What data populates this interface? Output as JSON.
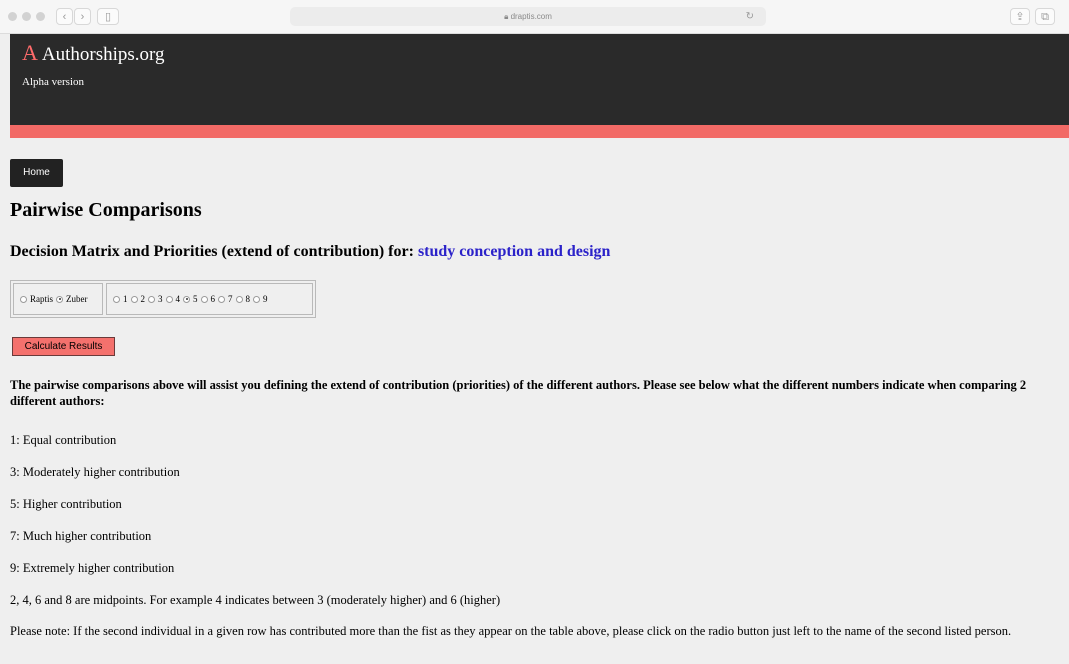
{
  "browser": {
    "url": "draptis.com",
    "icons": [
      "reader-icon",
      "reload-icon",
      "share-icon",
      "tabs-icon"
    ]
  },
  "site": {
    "logo_letter": "A",
    "name": "Authorships.org",
    "tagline": "Alpha version",
    "colors": {
      "header": "#2a2a2a",
      "accent": "#f26a66",
      "link": "#2b22c9"
    }
  },
  "nav": {
    "home_label": "Home"
  },
  "page": {
    "title": "Pairwise Comparisons",
    "subtitle_prefix": "Decision Matrix and Priorities (extend of contribution) for:",
    "criterion": "study conception and design"
  },
  "comparison": {
    "authors": [
      {
        "name": "Raptis",
        "selected": false
      },
      {
        "name": "Zuber",
        "selected": true
      }
    ],
    "scale": [
      {
        "label": "1",
        "selected": false
      },
      {
        "label": "2",
        "selected": false
      },
      {
        "label": "3",
        "selected": false
      },
      {
        "label": "4",
        "selected": false
      },
      {
        "label": "5",
        "selected": true
      },
      {
        "label": "6",
        "selected": false
      },
      {
        "label": "7",
        "selected": false
      },
      {
        "label": "8",
        "selected": false
      },
      {
        "label": "9",
        "selected": false
      }
    ]
  },
  "actions": {
    "calculate_label": "Calculate Results"
  },
  "explanation": {
    "intro": "The pairwise comparisons above will assist you defining the extend of contribution (priorities) of the different authors. Please see below what the different numbers indicate when comparing 2 different authors:",
    "legend": [
      "1: Equal contribution",
      "3: Moderately higher contribution",
      "5: Higher contribution",
      "7: Much higher contribution",
      "9: Extremely higher contribution",
      "2, 4, 6 and 8 are midpoints. For example 4 indicates between 3 (moderately higher) and 6 (higher)"
    ],
    "note": "Please note: If the second individual in a given row has contributed more than the fist as they appear on the table above, please click on the radio button just left to the name of the second listed person."
  }
}
